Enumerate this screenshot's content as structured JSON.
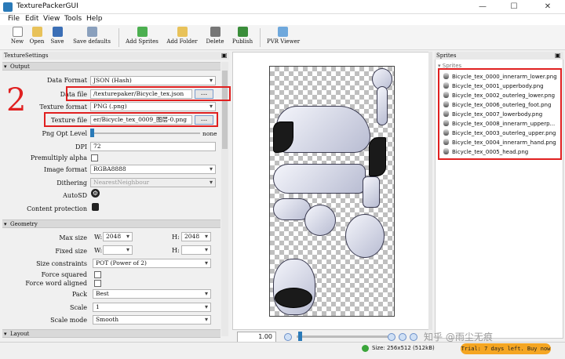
{
  "window": {
    "title": "TexturePackerGUI"
  },
  "menu": [
    "File",
    "Edit",
    "View",
    "Tools",
    "Help"
  ],
  "toolbar": [
    "New",
    "Open",
    "Save",
    "Save defaults",
    "Add Sprites",
    "Add Folder",
    "Delete",
    "Publish",
    "PVR Viewer"
  ],
  "left": {
    "panel_title": "TextureSettings",
    "output_header": "Output",
    "data_format_label": "Data Format",
    "data_format": "JSON (Hash)",
    "data_file_label": "Data file",
    "data_file": "/texturepaker/Bicycle_tex.json",
    "texture_format_label": "Texture format",
    "texture_format": "PNG (.png)",
    "texture_file_label": "Texture file",
    "texture_file": "er/Bicycle_tex_0009_图层-0.png",
    "png_opt_label": "Png Opt Level",
    "png_opt_value": "none",
    "dpi_label": "DPI",
    "dpi": "72",
    "premultiply_label": "Premultiply alpha",
    "image_format_label": "Image format",
    "image_format": "RGBA8888",
    "dithering_label": "Dithering",
    "dithering": "NearestNeighbour",
    "autosd_label": "AutoSD",
    "content_protection_label": "Content protection",
    "geometry_header": "Geometry",
    "max_size_label": "Max size",
    "w_label": "W:",
    "h_label": "H:",
    "max_w": "2048",
    "max_h": "2048",
    "fixed_size_label": "Fixed size",
    "fixed_w": "",
    "fixed_h": "",
    "size_constraints_label": "Size constraints",
    "size_constraints": "POT (Power of 2)",
    "force_squared_label": "Force squared",
    "force_word_label": "Force word aligned",
    "pack_label": "Pack",
    "pack": "Best",
    "scale_label": "Scale",
    "scale": "1",
    "scale_mode_label": "Scale mode",
    "scale_mode": "Smooth",
    "layout_header": "Layout",
    "browse": "..."
  },
  "annotations": {
    "left_number": "2",
    "right_number": "1"
  },
  "canvas": {
    "zoom": "1.00"
  },
  "sprites": {
    "panel_title": "Sprites",
    "root": "Sprites",
    "items": [
      "Bicycle_tex_0000_innerarm_lower.png",
      "Bicycle_tex_0001_upperbody.png",
      "Bicycle_tex_0002_outerleg_lower.png",
      "Bicycle_tex_0006_outerleg_foot.png",
      "Bicycle_tex_0007_lowerbody.png",
      "Bicycle_tex_0008_innerarm_upperp...",
      "Bicycle_tex_0003_outerleg_upper.png",
      "Bicycle_tex_0004_innerarm_hand.png",
      "Bicycle_tex_0005_head.png"
    ]
  },
  "status": {
    "size": "Size: 256x512 (512kB)",
    "trial": "Trial: 7 days left. Buy now",
    "watermark": "知乎 @雨尘无痕"
  },
  "colors": {
    "annotation_red": "#e02020",
    "trial_orange": "#f5a623"
  }
}
